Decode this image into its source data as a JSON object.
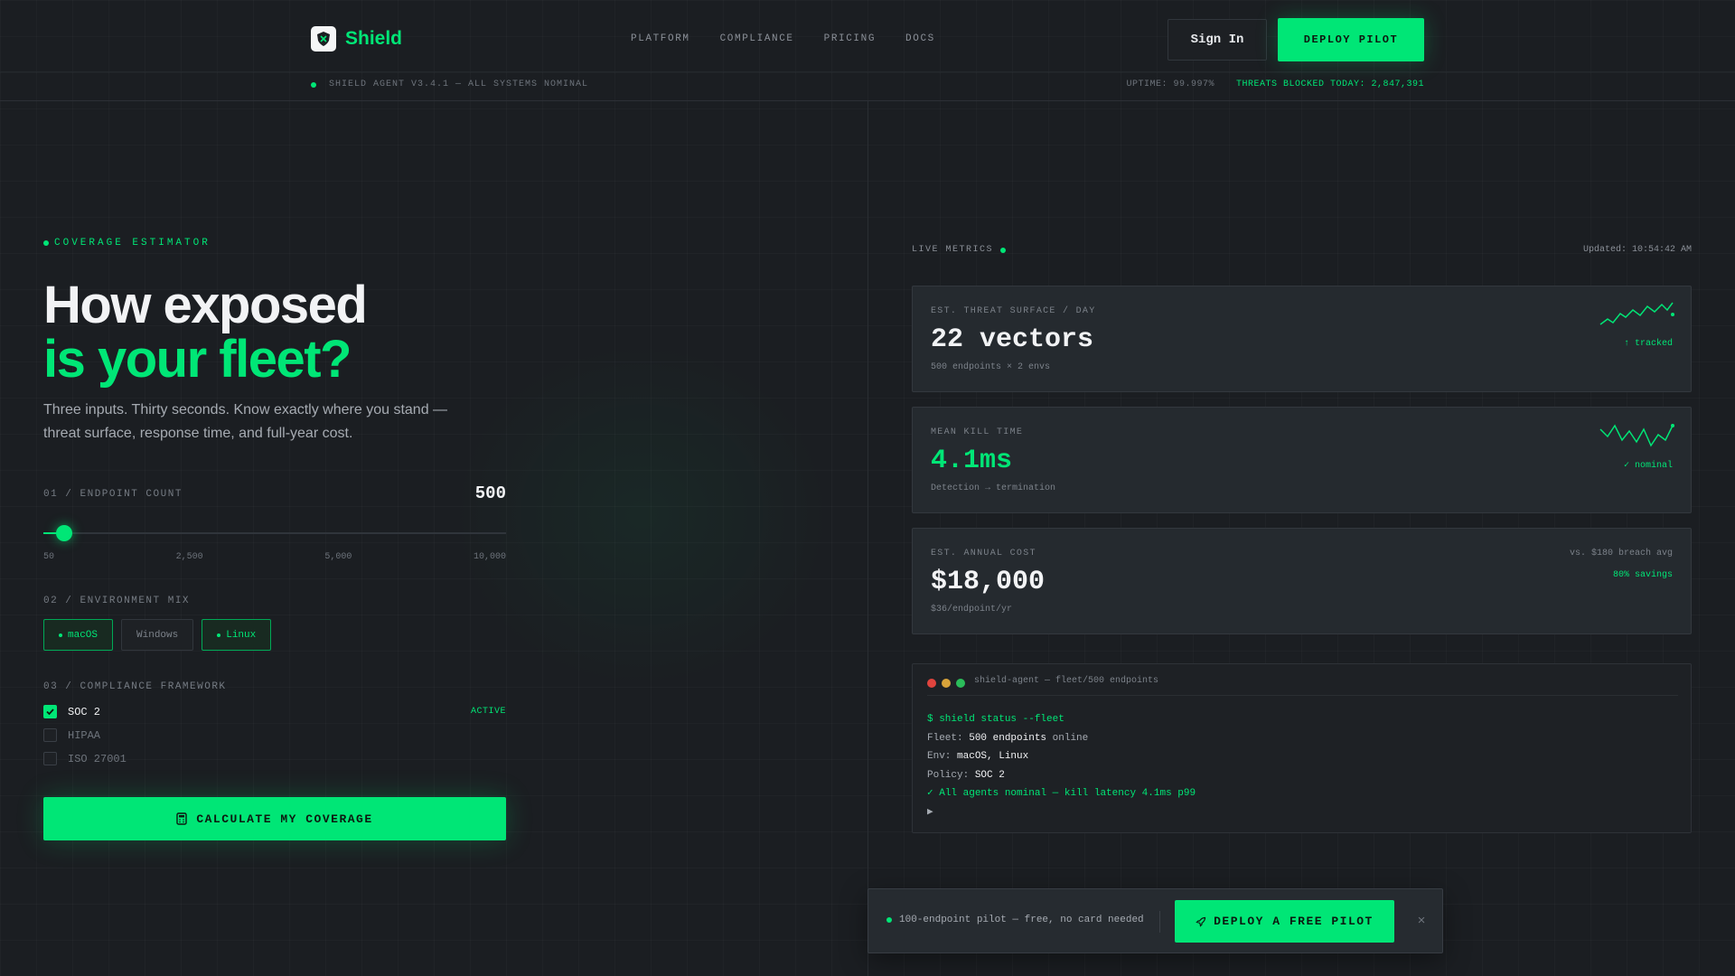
{
  "brand": {
    "name": "Shield"
  },
  "nav": [
    {
      "label": "PLATFORM"
    },
    {
      "label": "COMPLIANCE"
    },
    {
      "label": "PRICING"
    },
    {
      "label": "DOCS"
    }
  ],
  "header": {
    "signin_label": "Sign In",
    "deploy_label": "DEPLOY PILOT"
  },
  "status": {
    "agent": "SHIELD AGENT V3.4.1 — ALL SYSTEMS NOMINAL",
    "uptime": "UPTIME: 99.997%",
    "threats": "THREATS BLOCKED TODAY: 2,847,391"
  },
  "hero": {
    "eyebrow": "COVERAGE ESTIMATOR",
    "title_line1": "How exposed",
    "title_line2": "is your fleet?",
    "lede": "Three inputs. Thirty seconds. Know exactly where you stand — threat surface, response time, and full-year cost."
  },
  "estimator": {
    "endpoint_label": "01 / ENDPOINT COUNT",
    "endpoint_value": "500",
    "slider_fraction": 0.045,
    "ticks": [
      "50",
      "2,500",
      "5,000",
      "10,000"
    ],
    "env_label": "02 / ENVIRONMENT MIX",
    "envs": [
      {
        "label": "macOS",
        "selected": true
      },
      {
        "label": "Windows",
        "selected": false
      },
      {
        "label": "Linux",
        "selected": true
      }
    ],
    "compliance_label": "03 / COMPLIANCE FRAMEWORK",
    "frameworks": [
      {
        "label": "SOC 2",
        "checked": true,
        "tag": "ACTIVE"
      },
      {
        "label": "HIPAA",
        "checked": false
      },
      {
        "label": "ISO 27001",
        "checked": false
      }
    ],
    "calculate_label": "CALCULATE MY COVERAGE"
  },
  "metrics": {
    "live_label": "LIVE METRICS",
    "updated": "Updated: 10:54:42 AM",
    "cards": [
      {
        "key": "EST. THREAT SURFACE / DAY",
        "value": "22 vectors",
        "sub": "500 endpoints × 2 envs",
        "trend": "↑ tracked"
      },
      {
        "key": "MEAN KILL TIME",
        "value": "4.1ms",
        "sub": "Detection → termination",
        "trend": "✓ nominal"
      },
      {
        "key": "EST. ANNUAL COST",
        "value": "$18,000",
        "sub": "$36/endpoint/yr",
        "vs": "vs. $180 breach avg",
        "savings": "80% savings"
      }
    ]
  },
  "terminal": {
    "title": "shield-agent — fleet/500 endpoints",
    "command": "$ shield status --fleet",
    "fleet_prefix": "Fleet: ",
    "fleet_value": "500 endpoints",
    "fleet_suffix": " online",
    "env_prefix": "Env: ",
    "env_value": "macOS, Linux",
    "policy_prefix": "Policy: ",
    "policy_value": "SOC 2",
    "result": "✓ All agents nominal — kill latency 4.1ms p99",
    "cursor": "▶"
  },
  "toast": {
    "text": "100-endpoint pilot — free, no card needed",
    "button_label": "DEPLOY A FREE PILOT",
    "close": "×"
  },
  "colors": {
    "accent": "#00e676",
    "background": "#1b1e22",
    "card": "#252a2f"
  }
}
